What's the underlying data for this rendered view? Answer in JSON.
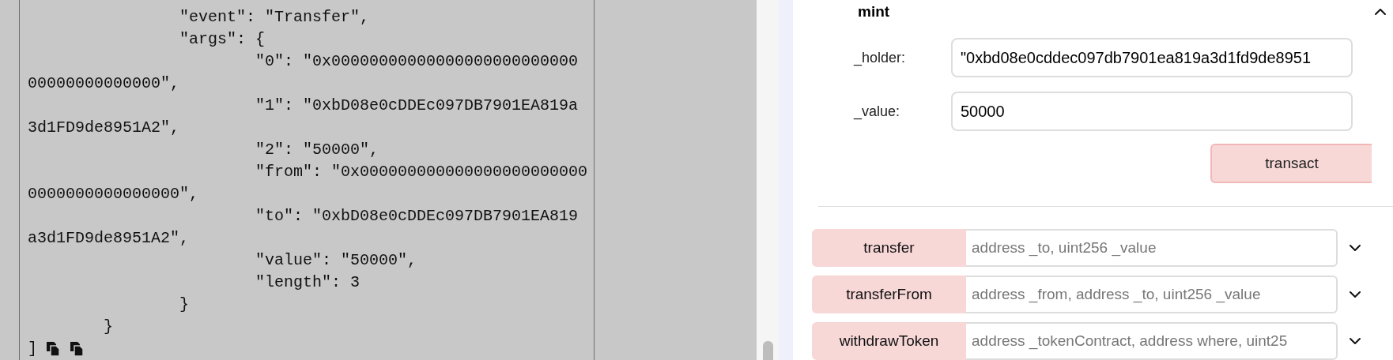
{
  "code_panel": {
    "lines": [
      "                \"event\": \"Transfer\",",
      "                \"args\": {",
      "                        \"0\": \"0x00000000000000000000000000",
      "00000000000000\",",
      "                        \"1\": \"0xbD08e0cDDEc097DB7901EA819a",
      "3d1FD9de8951A2\",",
      "                        \"2\": \"50000\",",
      "                        \"from\": \"0x000000000000000000000000",
      "0000000000000000\",",
      "                        \"to\": \"0xbD08e0cDDEc097DB7901EA819",
      "a3d1FD9de8951A2\",",
      "                        \"value\": \"50000\",",
      "                        \"length\": 3",
      "                }",
      "        }",
      "]"
    ]
  },
  "mint": {
    "name": "mint",
    "expanded": true,
    "params": [
      {
        "label": "_holder:",
        "value": "\"0xbd08e0cddec097db7901ea819a3d1fd9de8951"
      },
      {
        "label": "_value:",
        "value": "50000"
      }
    ],
    "button": "transact"
  },
  "functions": [
    {
      "name": "transfer",
      "placeholder": "address _to, uint256 _value",
      "expanded": false
    },
    {
      "name": "transferFrom",
      "placeholder": "address _from, address _to, uint256 _value",
      "expanded": false
    },
    {
      "name": "withdrawToken",
      "placeholder": "address _tokenContract, address where, uint25",
      "expanded": false
    }
  ]
}
